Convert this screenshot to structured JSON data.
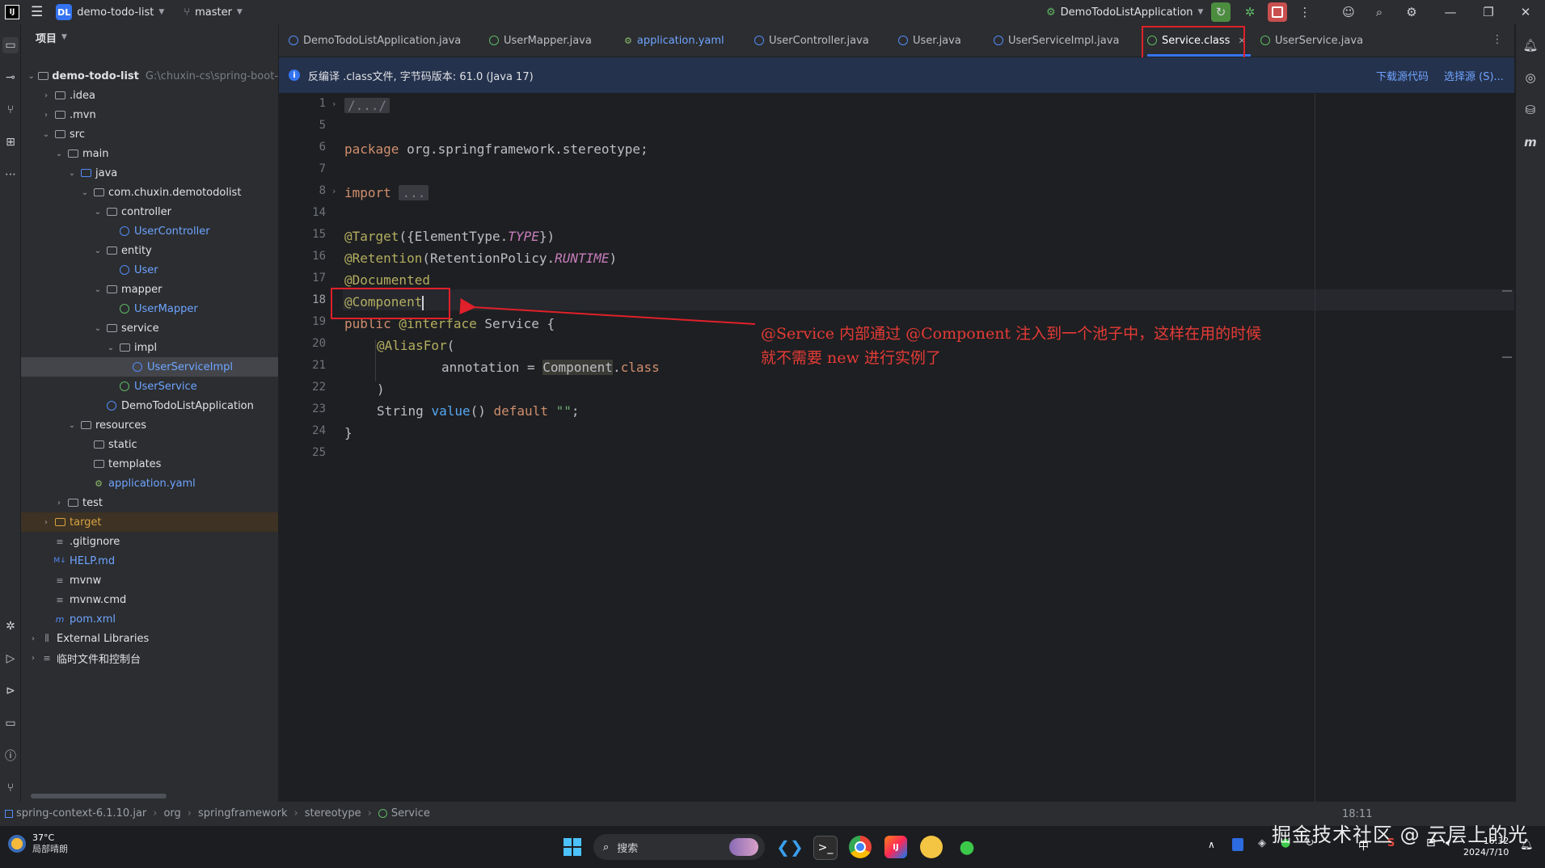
{
  "titlebar": {
    "project_chip": "DL",
    "project_name": "demo-todo-list",
    "branch": "master",
    "run_config": "DemoTodoListApplication"
  },
  "project_panel": {
    "title": "项目",
    "tree": [
      {
        "label": "demo-todo-list",
        "path": "G:\\chuxin-cs\\spring-boot-",
        "depth": 0,
        "kind": "module"
      },
      {
        "label": ".idea",
        "depth": 1,
        "kind": "folder"
      },
      {
        "label": ".mvn",
        "depth": 1,
        "kind": "folder"
      },
      {
        "label": "src",
        "depth": 1,
        "kind": "folder"
      },
      {
        "label": "main",
        "depth": 2,
        "kind": "folder"
      },
      {
        "label": "java",
        "depth": 3,
        "kind": "folder-blue"
      },
      {
        "label": "com.chuxin.demotodolist",
        "depth": 4,
        "kind": "package"
      },
      {
        "label": "controller",
        "depth": 5,
        "kind": "package"
      },
      {
        "label": "UserController",
        "depth": 6,
        "kind": "class"
      },
      {
        "label": "entity",
        "depth": 5,
        "kind": "package"
      },
      {
        "label": "User",
        "depth": 6,
        "kind": "class"
      },
      {
        "label": "mapper",
        "depth": 5,
        "kind": "package"
      },
      {
        "label": "UserMapper",
        "depth": 6,
        "kind": "interface"
      },
      {
        "label": "service",
        "depth": 5,
        "kind": "package"
      },
      {
        "label": "impl",
        "depth": 6,
        "kind": "package"
      },
      {
        "label": "UserServiceImpl",
        "depth": 7,
        "kind": "class"
      },
      {
        "label": "UserService",
        "depth": 6,
        "kind": "interface"
      },
      {
        "label": "DemoTodoListApplication",
        "depth": 5,
        "kind": "app"
      },
      {
        "label": "resources",
        "depth": 3,
        "kind": "folder"
      },
      {
        "label": "static",
        "depth": 4,
        "kind": "folder"
      },
      {
        "label": "templates",
        "depth": 4,
        "kind": "folder"
      },
      {
        "label": "application.yaml",
        "depth": 4,
        "kind": "yaml"
      },
      {
        "label": "test",
        "depth": 2,
        "kind": "folder"
      },
      {
        "label": "target",
        "depth": 1,
        "kind": "folder-orange"
      },
      {
        "label": ".gitignore",
        "depth": 1,
        "kind": "file"
      },
      {
        "label": "HELP.md",
        "depth": 1,
        "kind": "md"
      },
      {
        "label": "mvnw",
        "depth": 1,
        "kind": "file"
      },
      {
        "label": "mvnw.cmd",
        "depth": 1,
        "kind": "file"
      },
      {
        "label": "pom.xml",
        "depth": 1,
        "kind": "maven"
      },
      {
        "label": "External Libraries",
        "depth": 0,
        "kind": "lib"
      },
      {
        "label": "临时文件和控制台",
        "depth": 0,
        "kind": "scratch"
      }
    ]
  },
  "tabs": [
    {
      "label": "DemoTodoListApplication.java",
      "icon": "class"
    },
    {
      "label": "UserMapper.java",
      "icon": "interface"
    },
    {
      "label": "application.yaml",
      "icon": "yaml"
    },
    {
      "label": "UserController.java",
      "icon": "class"
    },
    {
      "label": "User.java",
      "icon": "class"
    },
    {
      "label": "UserServiceImpl.java",
      "icon": "class"
    },
    {
      "label": "Service.class",
      "icon": "annotation",
      "active": true
    },
    {
      "label": "UserService.java",
      "icon": "interface"
    }
  ],
  "infobar": {
    "icon": "i",
    "text": "反编译 .class文件, 字节码版本: 61.0 (Java 17)",
    "download_link": "下载源代码",
    "choose_link": "选择源 (S)..."
  },
  "code": {
    "line_numbers": [
      "1",
      "5",
      "6",
      "7",
      "8",
      "14",
      "15",
      "16",
      "17",
      "18",
      "19",
      "20",
      "21",
      "22",
      "23",
      "24",
      "25"
    ],
    "current_line": "18",
    "lines": {
      "l1": "/.../",
      "l6_kw": "package",
      "l6_rest": " org.springframework.stereotype;",
      "l8_kw": "import",
      "l8_fold": "...",
      "l15_ann": "@Target",
      "l15_a": "({ElementType.",
      "l15_it": "TYPE",
      "l15_b": "})",
      "l16_ann": "@Retention",
      "l16_a": "(RetentionPolicy.",
      "l16_it": "RUNTIME",
      "l16_b": ")",
      "l17_ann": "@Documented",
      "l18_ann": "@Component",
      "l19_kw": "public",
      "l19_ann": " @interface",
      "l19_rest": " Service {",
      "l20_ann": "@AliasFor",
      "l20_rest": "(",
      "l21_a": "annotation = ",
      "l21_hl": "Component",
      "l21_b": ".",
      "l21_kw": "class",
      "l22": ")",
      "l23_a": "String ",
      "l23_fn": "value",
      "l23_b": "() ",
      "l23_kw": "default",
      "l23_c": " ",
      "l23_str": "\"\"",
      "l23_d": ";",
      "l24": "}"
    }
  },
  "annotation_note": {
    "line1": "@Service 内部通过 @Component 注入到一个池子中，这样在用的时候",
    "line2": "就不需要 new 进行实例了",
    "color": "#e53b36"
  },
  "breadcrumbs": [
    "spring-context-6.1.10.jar",
    "org",
    "springframework",
    "stereotype",
    "Service"
  ],
  "status": {
    "position": "18:11"
  },
  "taskbar": {
    "temp": "37°C",
    "weather": "局部晴朗",
    "search_placeholder": "搜索",
    "time": "16:32",
    "date": "2024/7/10",
    "ime": "中"
  },
  "watermark": "掘金技术社区 @ 云层上的光"
}
